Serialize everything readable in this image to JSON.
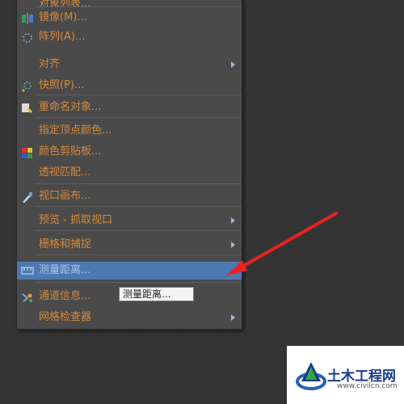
{
  "menu": {
    "items": [
      {
        "label": "对象列表...",
        "icon": "object-list-icon"
      },
      {
        "label": "镜像(M)...",
        "icon": "mirror-icon"
      },
      {
        "label": "阵列(A)...",
        "icon": "array-icon"
      },
      {
        "label": "对齐",
        "icon": "",
        "submenu": true
      },
      {
        "label": "快照(P)...",
        "icon": "snapshot-icon"
      },
      {
        "label": "重命名对象...",
        "icon": "rename-object-icon"
      },
      {
        "label": "指定顶点颜色...",
        "icon": ""
      },
      {
        "label": "颜色剪贴板...",
        "icon": "color-clipboard-icon"
      },
      {
        "label": "透视匹配...",
        "icon": ""
      },
      {
        "label": "视口画布...",
        "icon": "viewport-canvas-icon"
      },
      {
        "label": "预览 - 抓取视口",
        "icon": "",
        "submenu": true
      },
      {
        "label": "栅格和捕捉",
        "icon": "",
        "submenu": true
      },
      {
        "label": "测量距离...",
        "icon": "measure-distance-icon",
        "highlighted": true
      },
      {
        "label": "通道信息...",
        "icon": "channel-info-icon"
      },
      {
        "label": "网格检查器",
        "icon": "",
        "submenu": true
      }
    ]
  },
  "tooltip": {
    "text": "测量距离..."
  },
  "watermark": {
    "title": "土木工程网",
    "url": "www.civilcn.com"
  },
  "colors": {
    "menu_text": "#d8893a",
    "highlight_bg": "#4e78b4",
    "pointer_red": "#e8231f"
  }
}
